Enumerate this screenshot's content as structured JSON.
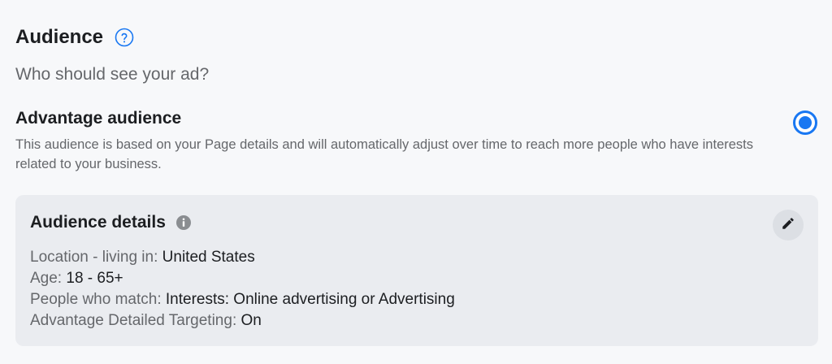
{
  "audience": {
    "heading": "Audience",
    "help_icon": "question-circle-icon",
    "subheading": "Who should see your ad?"
  },
  "option": {
    "title": "Advantage audience",
    "description": "This audience is based on your Page details and will automatically adjust over time to reach more people who have interests related to your business.",
    "selected": true
  },
  "details": {
    "title": "Audience details",
    "info_icon": "info-icon",
    "edit_icon": "pencil-icon",
    "lines": [
      {
        "label": "Location - living in: ",
        "value": "United States"
      },
      {
        "label": "Age: ",
        "value": "18 - 65+"
      },
      {
        "label": "People who match: ",
        "value": "Interests: Online advertising or Advertising"
      },
      {
        "label": "Advantage Detailed Targeting: ",
        "value": "On"
      }
    ]
  },
  "colors": {
    "accent": "#1877f2",
    "card_bg": "#eaecf0",
    "page_bg": "#f7f8fa",
    "secondary_text": "#65676b"
  }
}
